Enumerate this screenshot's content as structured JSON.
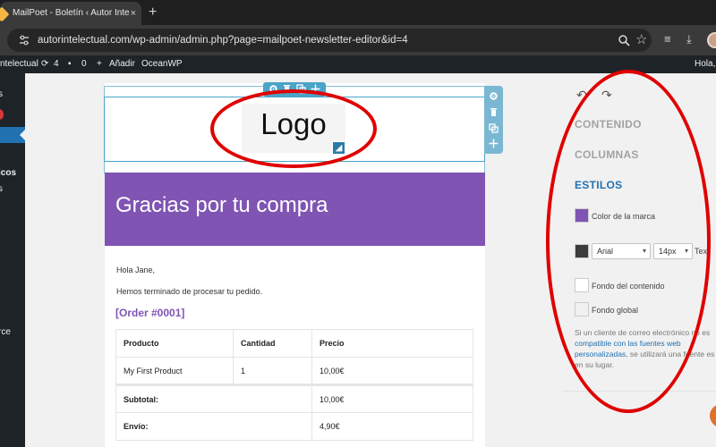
{
  "browser": {
    "tab_title": "MailPoet - Boletín ‹ Autor Inte",
    "tab_close": "×",
    "new_tab": "+",
    "url": "autorintelectual.com/wp-admin/admin.php?page=mailpoet-newsletter-editor&id=4"
  },
  "wp_admin_bar": {
    "site_name": "ntelectual",
    "updates_count": "4",
    "comments_count": "0",
    "new_label": "Añadir",
    "theme_label": "OceanWP",
    "greeting": "Hola, "
  },
  "admin_menu": {
    "item_top": "s",
    "item_graphics": "icos",
    "item_graphics_sub": "s",
    "item_commerce": "rce"
  },
  "email": {
    "logo_text": "Logo",
    "header_title": "Gracias por tu compra",
    "greeting": "Hola Jane,",
    "intro": "Hemos terminado de procesar tu pedido.",
    "order_link": "[Order #0001]",
    "table": {
      "headers": [
        "Producto",
        "Cantidad",
        "Precio"
      ],
      "rows": [
        [
          "My First Product",
          "1",
          "10,00€"
        ]
      ],
      "subtotal_label": "Subtotal:",
      "subtotal_value": "10,00€",
      "shipping_label": "Envío:",
      "shipping_value": "4,90€"
    }
  },
  "panel": {
    "sections": [
      "CONTENIDO",
      "COLUMNAS",
      "ESTILOS"
    ],
    "brand_color_label": "Color de la marca",
    "brand_color": "#7f54b3",
    "text_color": "#3c3c3c",
    "font_family": "Arial",
    "font_size": "14px",
    "text_label": "Text",
    "content_bg_label": "Fondo del contenido",
    "global_bg_label": "Fondo global",
    "note_pre": "Si un cliente de correo electrónico no es ",
    "note_link": "compatible con las fuentes web personalizadas",
    "note_post": ", se utilizará una fuente es en su lugar."
  },
  "colors": {
    "accent_blue": "#2271b1",
    "header_purple": "#7f54b3",
    "annotation_red": "#e00000"
  }
}
